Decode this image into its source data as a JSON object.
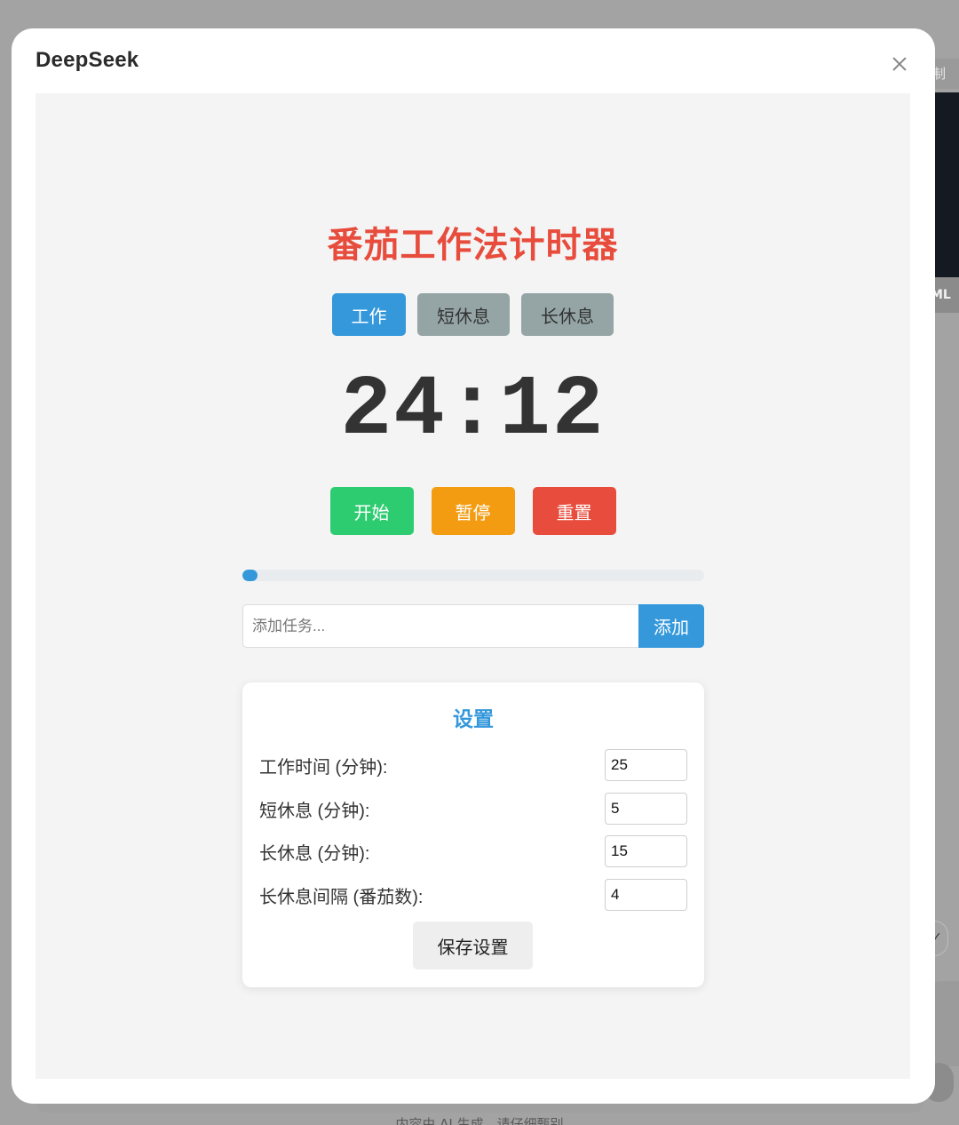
{
  "background": {
    "copy_label": "制",
    "html_label": "ML",
    "circle_glyph": "✓",
    "footer_text": "内容由 AI 生成，请仔细甄别"
  },
  "modal": {
    "title": "DeepSeek",
    "close_icon": "close-icon"
  },
  "app": {
    "title": "番茄工作法计时器",
    "modes": [
      {
        "label": "工作",
        "active": true
      },
      {
        "label": "短休息",
        "active": false
      },
      {
        "label": "长休息",
        "active": false
      }
    ],
    "timer": "24:12",
    "controls": {
      "start": "开始",
      "pause": "暂停",
      "reset": "重置"
    },
    "progress_fraction": 0.032,
    "task": {
      "placeholder": "添加任务...",
      "value": "",
      "add_label": "添加"
    },
    "settings": {
      "title": "设置",
      "rows": [
        {
          "label": "工作时间 (分钟):",
          "value": "25"
        },
        {
          "label": "短休息 (分钟):",
          "value": "5"
        },
        {
          "label": "长休息 (分钟):",
          "value": "15"
        },
        {
          "label": "长休息间隔 (番茄数):",
          "value": "4"
        }
      ],
      "save_label": "保存设置"
    }
  },
  "colors": {
    "accent_blue": "#3498db",
    "title_red": "#e74c3c",
    "start_green": "#2ecc71",
    "pause_orange": "#f39c12",
    "reset_red": "#e74c3c",
    "mode_inactive": "#95a5a6"
  }
}
